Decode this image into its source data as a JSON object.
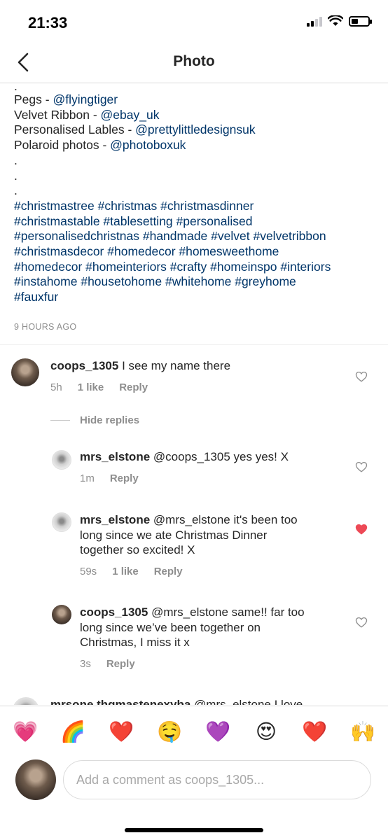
{
  "status": {
    "time": "21:33"
  },
  "nav": {
    "title": "Photo"
  },
  "caption": {
    "lead_dot": ".",
    "lines": [
      {
        "label": "Pegs - ",
        "handle": "@flyingtiger"
      },
      {
        "label": "Velvet Ribbon - ",
        "handle": "@ebay_uk"
      },
      {
        "label": "Personalised Lables - ",
        "handle": "@prettylittledesignsuk"
      },
      {
        "label": "Polaroid photos - ",
        "handle": "@photoboxuk"
      }
    ],
    "dots": [
      ".",
      ".",
      "."
    ],
    "hashtags_lines": [
      "#christmastree #christmas #christmasdinner",
      "#christmastable #tablesetting #personalised",
      "#personalisedchristnas #handmade #velvet #velvetribbon",
      "#christmasdecor #homedecor #homesweethome",
      "#homedecor #homeinteriors #crafty #homeinspo #interiors",
      "#instahome #housetohome #whitehome #greyhome",
      "#fauxfur"
    ],
    "time_ago": "9 HOURS AGO"
  },
  "comments": [
    {
      "user": "coops_1305",
      "text": "I see my name there",
      "time": "5h",
      "likes": "1 like",
      "reply": "Reply",
      "liked": false
    },
    {
      "user": "mrs_elstone",
      "text": "@coops_1305 yes yes! X",
      "time": "1m",
      "likes": "",
      "reply": "Reply",
      "liked": false
    },
    {
      "user": "mrs_elstone",
      "text_lines": [
        "@mrs_elstone it's been too",
        "long since we ate Christmas Dinner",
        "together so excited! X"
      ],
      "time": "59s",
      "likes": "1 like",
      "reply": "Reply",
      "liked": true
    },
    {
      "user": "coops_1305",
      "text_lines": [
        "@mrs_elstone same!! far too",
        "long since we’ve been together on",
        "Christmas, I miss it x"
      ],
      "time": "3s",
      "likes": "",
      "reply": "Reply",
      "liked": false
    },
    {
      "user": "mrsone.thgmastenexyba",
      "text": "@mrs_elstone I love"
    }
  ],
  "hide_replies": "Hide replies",
  "emojis": [
    "💗",
    "🌈",
    "❤️",
    "🤤",
    "💜",
    "😍",
    "❤️",
    "🙌"
  ],
  "composer": {
    "placeholder": "Add a comment as coops_1305..."
  },
  "colors": {
    "link": "#003569",
    "muted": "#8e8e8e",
    "heart_liked": "#ed4956"
  }
}
